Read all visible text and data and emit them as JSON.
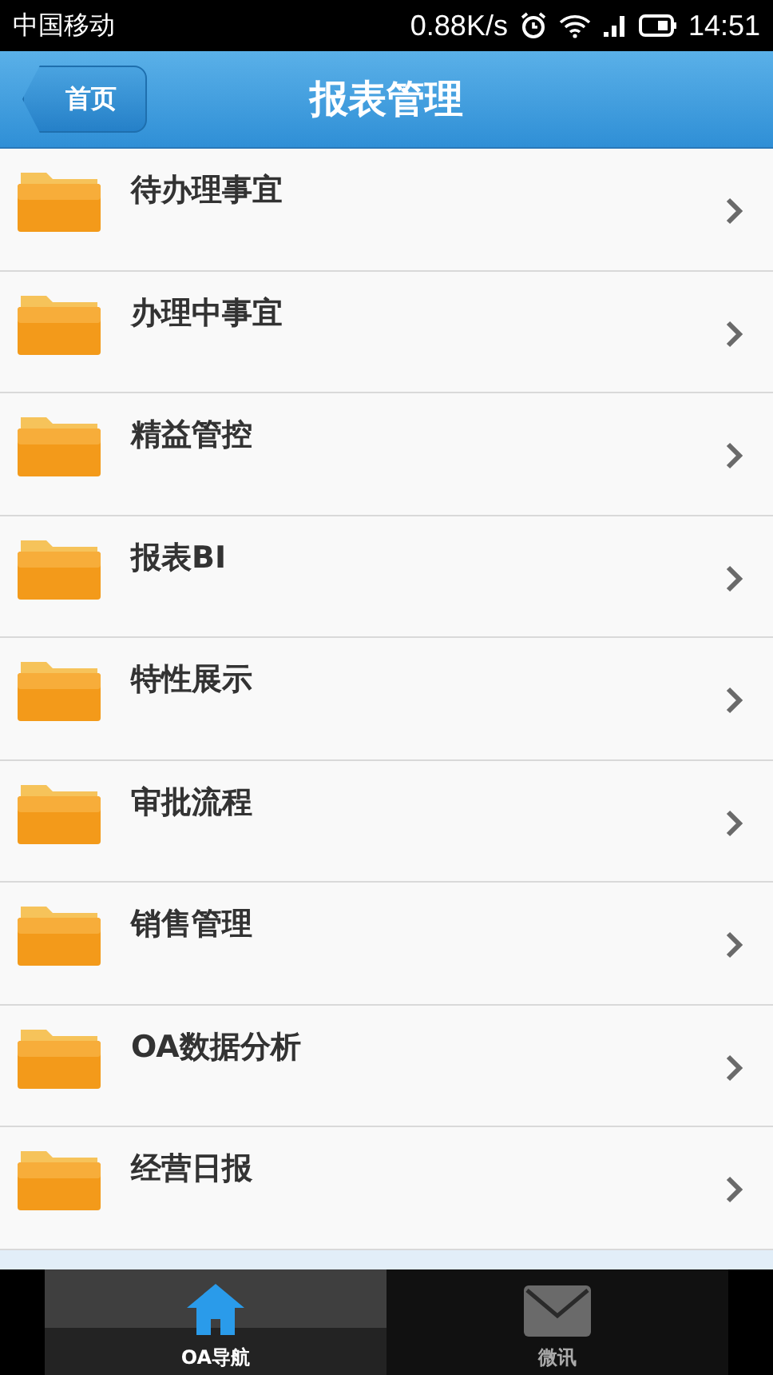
{
  "status_bar": {
    "carrier": "中国移动",
    "speed": "0.88K/s",
    "time": "14:51"
  },
  "header": {
    "back": "首页",
    "title": "报表管理"
  },
  "items": [
    {
      "label": "待办理事宜"
    },
    {
      "label": "办理中事宜"
    },
    {
      "label": "精益管控"
    },
    {
      "label": "报表BI"
    },
    {
      "label": "特性展示"
    },
    {
      "label": "审批流程"
    },
    {
      "label": "销售管理"
    },
    {
      "label": "OA数据分析"
    },
    {
      "label": "经营日报"
    }
  ],
  "tabs": [
    {
      "label": "OA导航",
      "kind": "home",
      "selected": true
    },
    {
      "label": "微讯",
      "kind": "mail",
      "selected": false
    }
  ]
}
